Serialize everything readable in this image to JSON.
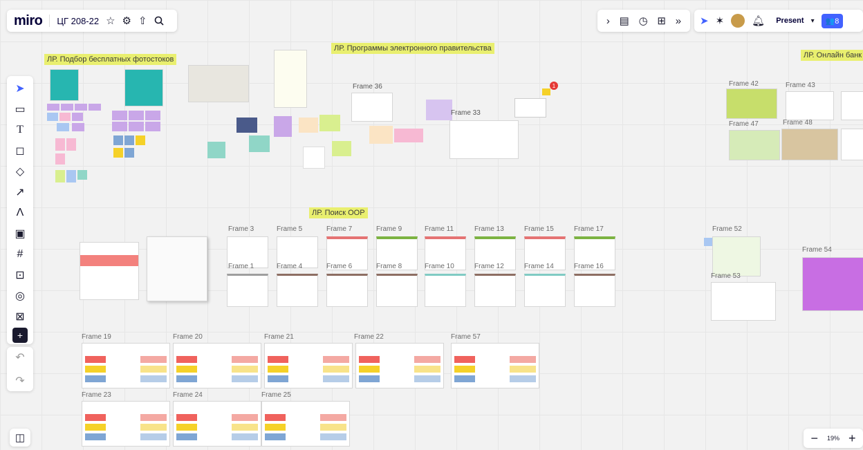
{
  "app": {
    "logo": "miro",
    "board_name": "ЦГ 208-22",
    "star_icon": "star-icon",
    "settings_icon": "gear-icon",
    "share_icon": "upload-icon",
    "search_icon": "search-icon"
  },
  "top_right": {
    "present_label": "Present",
    "share_label": "8"
  },
  "sections": {
    "photostock": "ЛР. Подбор бесплатных фотостоков",
    "egov": "ЛР. Программы электронного правительства",
    "bank": "ЛР. Онлайн банк",
    "oer": "ЛР. Поиск ООР"
  },
  "frames": {
    "f36": "Frame 36",
    "f33": "Frame 33",
    "f42": "Frame 42",
    "f43": "Frame 43",
    "f47": "Frame 47",
    "f48": "Frame 48",
    "f52": "Frame 52",
    "f53": "Frame 53",
    "f54": "Frame 54",
    "f3": "Frame 3",
    "f5": "Frame 5",
    "f7": "Frame 7",
    "f9": "Frame 9",
    "f11": "Frame 11",
    "f13": "Frame 13",
    "f15": "Frame 15",
    "f17": "Frame 17",
    "f1": "Frame 1",
    "f4": "Frame 4",
    "f6": "Frame 6",
    "f8": "Frame 8",
    "f10": "Frame 10",
    "f12": "Frame 12",
    "f14": "Frame 14",
    "f16": "Frame 16",
    "f19": "Frame 19",
    "f20": "Frame 20",
    "f21": "Frame 21",
    "f22": "Frame 22",
    "f57": "Frame 57",
    "f23": "Frame 23",
    "f24": "Frame 24",
    "f25": "Frame 25"
  },
  "notification_count": "1",
  "zoom": {
    "level": "19%",
    "minus": "−",
    "plus": "+"
  },
  "colors": {
    "accent": "#4262ff",
    "sticker": "#e9ef6f",
    "note_red": "#f0625d",
    "note_yellow": "#f5d128",
    "note_blue": "#7fa6d4",
    "note_purple": "#c9a7e8",
    "note_pink": "#f7b9d3"
  }
}
